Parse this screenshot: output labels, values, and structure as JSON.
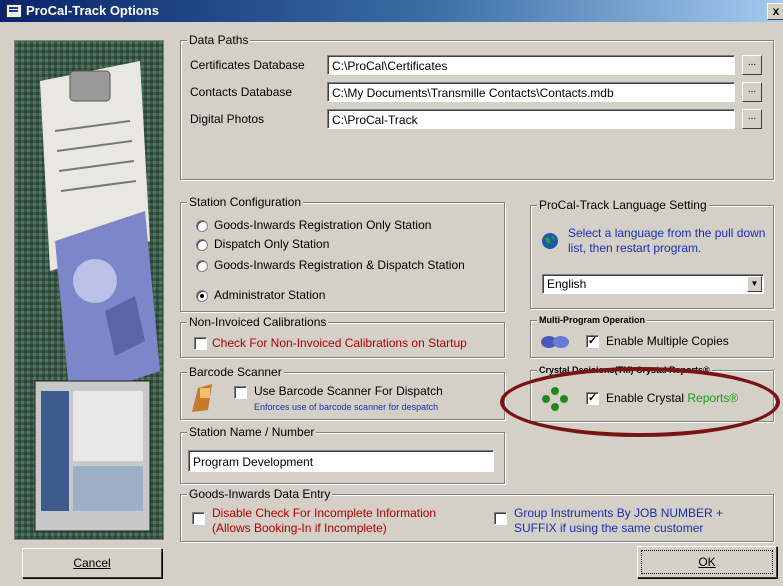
{
  "window": {
    "title": "ProCal-Track Options",
    "close_glyph": "x"
  },
  "data_paths": {
    "title": "Data Paths",
    "certificates": {
      "label": "Certificates Database",
      "value": "C:\\ProCal\\Certificates"
    },
    "contacts": {
      "label": "Contacts Database",
      "value": "C:\\My Documents\\Transmille Contacts\\Contacts.mdb"
    },
    "photos": {
      "label": "Digital Photos",
      "value": "C:\\ProCal-Track"
    },
    "browse_label": "..."
  },
  "station_config": {
    "title": "Station Configuration",
    "options": [
      "Goods-Inwards Registration Only Station",
      "Dispatch Only Station",
      "Goods-Inwards Registration & Dispatch Station",
      "Administrator Station"
    ]
  },
  "language": {
    "title": "ProCal-Track Language Setting",
    "info": "Select a language from the pull down list, then restart program.",
    "selected": "English",
    "arrow": "▼"
  },
  "non_invoiced": {
    "title": "Non-Invoiced Calibrations",
    "check_label": "Check For Non-Invoiced Calibrations on Startup"
  },
  "multi_program": {
    "title": "Multi-Program Operation",
    "check_label": "Enable Multiple Copies"
  },
  "barcode": {
    "title": "Barcode Scanner",
    "check_label": "Use Barcode Scanner For Dispatch",
    "note": "Enforces use of barcode scanner for despatch"
  },
  "crystal": {
    "title": "Crystal Decisions(TM) Crystal Reports®",
    "check_prefix": "Enable Crystal ",
    "check_suffix": "Reports®"
  },
  "station_name": {
    "title": "Station Name / Number",
    "value": "Program Development"
  },
  "goods_inwards": {
    "title": "Goods-Inwards Data Entry",
    "disable_check": "Disable Check For Incomplete Information",
    "disable_note": "(Allows Booking-In if Incomplete)",
    "group_line1": "Group Instruments By JOB  NUMBER +",
    "group_line2": "SUFFIX if using the same customer"
  },
  "buttons": {
    "cancel": "Cancel",
    "ok": "OK"
  },
  "check_mark": "✓",
  "colors": {
    "title_bar": "#0a246a",
    "highlight_ellipse": "#7a1414",
    "red_text": "#b00000",
    "blue_text": "#1a2fb0",
    "green_text": "#1a9a1a"
  }
}
